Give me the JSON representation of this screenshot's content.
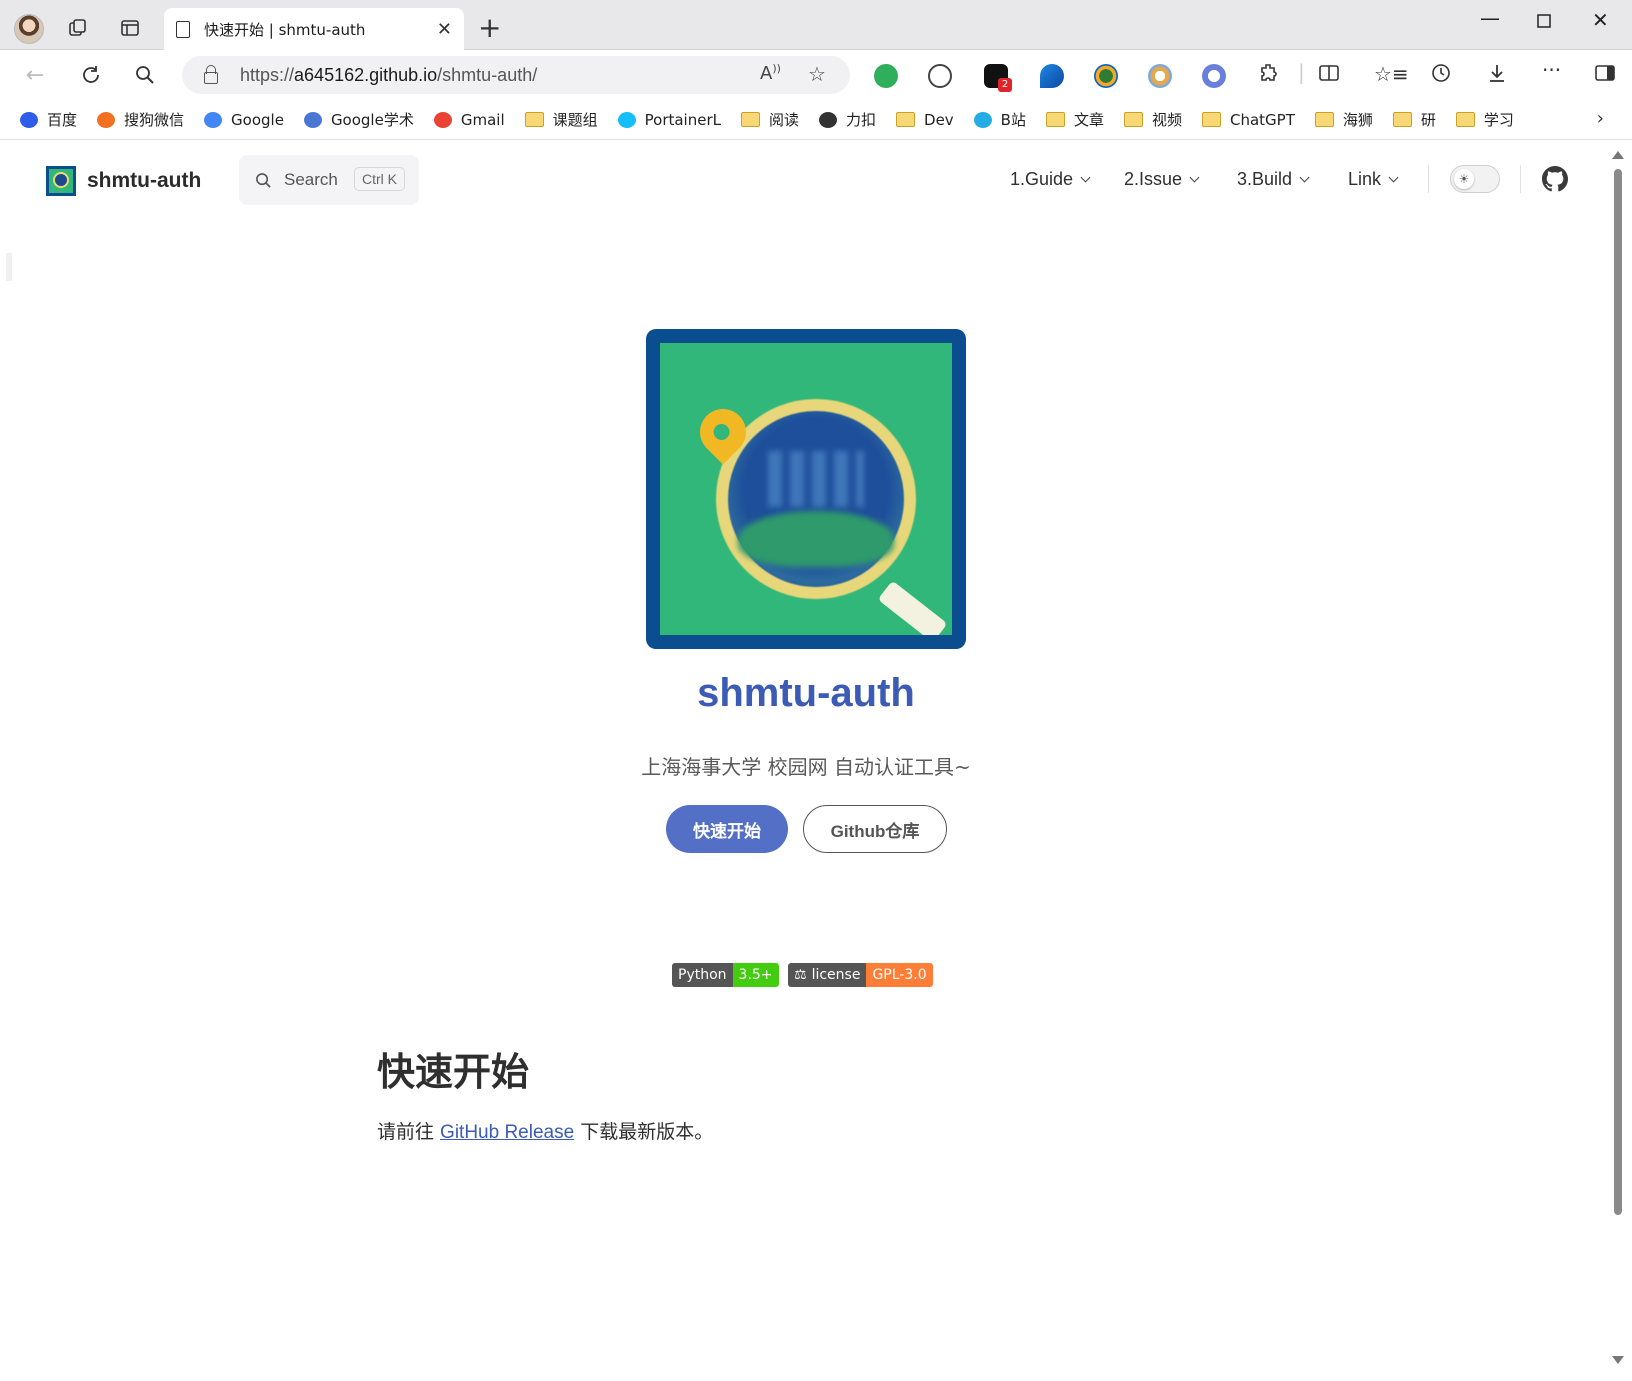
{
  "browser": {
    "tab_title": "快速开始 | shmtu-auth",
    "url_prefix": "https://",
    "url_host": "a645162.github.io",
    "url_path": "/shmtu-auth/",
    "extension_badge": "2"
  },
  "bookmarks": [
    {
      "label": "百度",
      "icon": "baidu-icon",
      "color": "#2e5ee7"
    },
    {
      "label": "搜狗微信",
      "icon": "sogou-icon",
      "color": "#f36f21"
    },
    {
      "label": "Google",
      "icon": "google-icon",
      "color": "#4285f4"
    },
    {
      "label": "Google学术",
      "icon": "scholar-icon",
      "color": "#4a77d4"
    },
    {
      "label": "Gmail",
      "icon": "gmail-icon",
      "color": "#ea4335"
    },
    {
      "label": "课题组",
      "icon": "folder-icon",
      "color": "#f8d775"
    },
    {
      "label": "PortainerL",
      "icon": "portainer-icon",
      "color": "#13bef9"
    },
    {
      "label": "阅读",
      "icon": "folder-icon",
      "color": "#f8d775"
    },
    {
      "label": "力扣",
      "icon": "leetcode-icon",
      "color": "#333333"
    },
    {
      "label": "Dev",
      "icon": "folder-icon",
      "color": "#f8d775"
    },
    {
      "label": "B站",
      "icon": "bilibili-icon",
      "color": "#23ade5"
    },
    {
      "label": "文章",
      "icon": "folder-icon",
      "color": "#f8d775"
    },
    {
      "label": "视频",
      "icon": "folder-icon",
      "color": "#f8d775"
    },
    {
      "label": "ChatGPT",
      "icon": "folder-icon",
      "color": "#f8d775"
    },
    {
      "label": "海狮",
      "icon": "folder-icon",
      "color": "#f8d775"
    },
    {
      "label": "研",
      "icon": "folder-icon",
      "color": "#f8d775"
    },
    {
      "label": "学习",
      "icon": "folder-icon",
      "color": "#f8d775"
    }
  ],
  "site": {
    "name": "shmtu-auth",
    "search_label": "Search",
    "search_shortcut": "Ctrl K",
    "nav": [
      "1.Guide",
      "2.Issue",
      "3.Build",
      "Link"
    ]
  },
  "hero": {
    "title": "shmtu-auth",
    "tagline": "上海海事大学 校园网 自动认证工具~",
    "primary_button": "快速开始",
    "secondary_button": "Github仓库"
  },
  "badges": [
    {
      "left": "Python",
      "right": "3.5+",
      "color": "#4c1"
    },
    {
      "left": "license",
      "right": "GPL-3.0",
      "color": "#fe7d37"
    }
  ],
  "doc": {
    "heading": "快速开始",
    "para_before": "请前往 ",
    "link_text": "GitHub Release",
    "para_after": " 下载最新版本。"
  },
  "colors": {
    "brand": "#3c5bb5",
    "primary_button": "#5470c6",
    "logo_frame": "#0a4e8f",
    "logo_bg": "#31b77a"
  }
}
